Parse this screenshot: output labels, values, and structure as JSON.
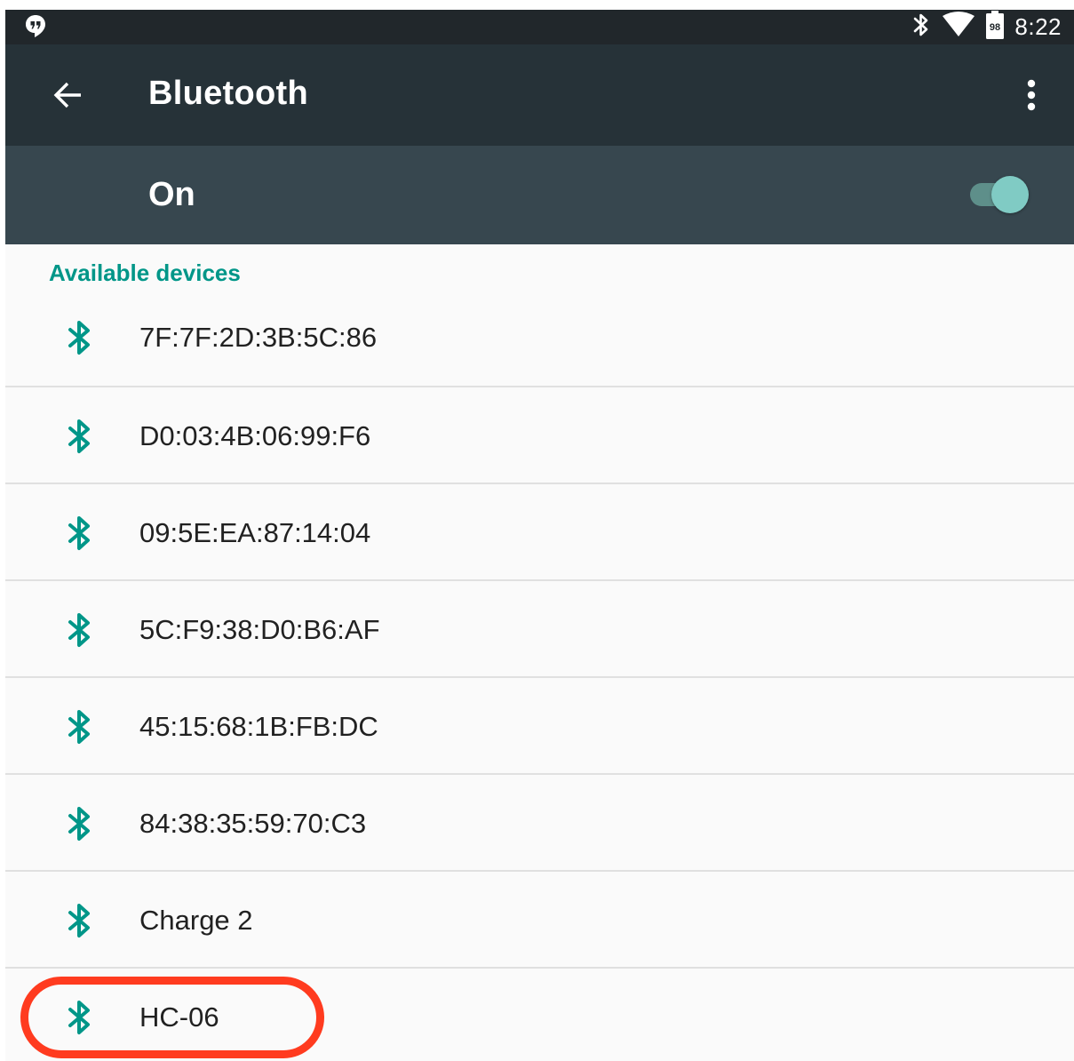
{
  "status_bar": {
    "left_icon": "hangouts-icon",
    "icons": [
      "bluetooth-icon",
      "wifi-icon",
      "battery-icon"
    ],
    "battery_level": "98",
    "time": "8:22"
  },
  "app_bar": {
    "back_icon": "arrow-back-icon",
    "title": "Bluetooth",
    "overflow_icon": "more-vert-icon"
  },
  "master_switch": {
    "label": "On",
    "state": true,
    "accent_color": "#80cbc4"
  },
  "available_devices": {
    "header": "Available devices",
    "header_color": "#009688",
    "devices": [
      {
        "name": "7F:7F:2D:3B:5C:86",
        "icon": "bluetooth-icon"
      },
      {
        "name": "D0:03:4B:06:99:F6",
        "icon": "bluetooth-icon"
      },
      {
        "name": "09:5E:EA:87:14:04",
        "icon": "bluetooth-icon"
      },
      {
        "name": "5C:F9:38:D0:B6:AF",
        "icon": "bluetooth-icon"
      },
      {
        "name": "45:15:68:1B:FB:DC",
        "icon": "bluetooth-icon"
      },
      {
        "name": "84:38:35:59:70:C3",
        "icon": "bluetooth-icon"
      },
      {
        "name": "Charge 2",
        "icon": "bluetooth-icon"
      },
      {
        "name": "HC-06",
        "icon": "bluetooth-icon",
        "highlighted": true
      }
    ]
  },
  "annotation": {
    "highlight_color": "#ff3b1f"
  }
}
